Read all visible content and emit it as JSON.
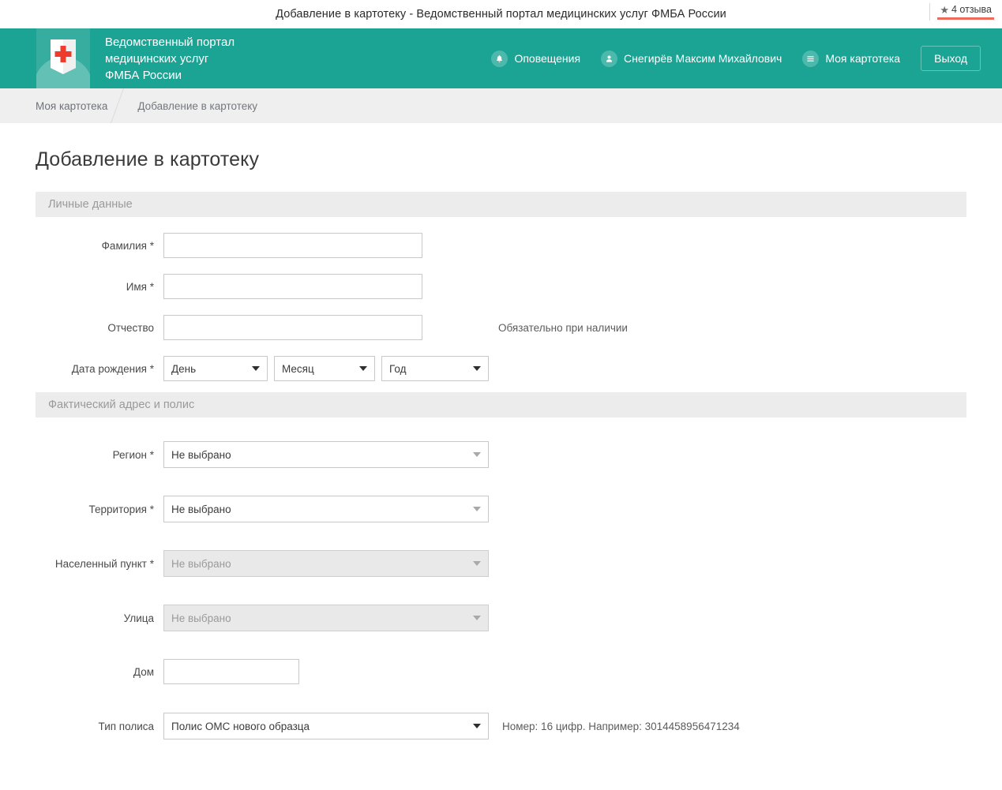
{
  "browser": {
    "title": "Добавление в картотеку - Ведомственный портал медицинских услуг ФМБА России",
    "review_badge": {
      "star": "★",
      "text": "4 отзыва"
    }
  },
  "header": {
    "brand_line1": "Ведомственный портал",
    "brand_line2": "медицинских услуг",
    "brand_line3": "ФМБА России",
    "nav": [
      {
        "label": "Оповещения",
        "icon": "bell-icon"
      },
      {
        "label": "Снегирёв Максим Михайлович",
        "icon": "user-icon"
      },
      {
        "label": "Моя картотека",
        "icon": "list-icon"
      }
    ],
    "logout_label": "Выход",
    "accent_color": "#1ba394"
  },
  "breadcrumb": {
    "items": [
      {
        "label": "Моя картотека"
      },
      {
        "label": "Добавление в картотеку"
      }
    ]
  },
  "main": {
    "page_title": "Добавление в картотеку",
    "sections": [
      {
        "title": "Личные данные"
      },
      {
        "title": "Фактический адрес и полис"
      }
    ],
    "personal": {
      "surname": {
        "label": "Фамилия *",
        "value": "",
        "placeholder": ""
      },
      "firstname": {
        "label": "Имя *",
        "value": "",
        "placeholder": ""
      },
      "patronymic": {
        "label": "Отчество",
        "value": "",
        "placeholder": "",
        "hint": "Обязательно при наличии"
      },
      "birthdate": {
        "label": "Дата рождения *",
        "day": "День",
        "month": "Месяц",
        "year": "Год"
      }
    },
    "address": {
      "region": {
        "label": "Регион *",
        "value": "Не выбрано",
        "disabled": false
      },
      "territory": {
        "label": "Территория *",
        "value": "Не выбрано",
        "disabled": false
      },
      "locality": {
        "label": "Населенный пункт *",
        "value": "Не выбрано",
        "disabled": true
      },
      "street": {
        "label": "Улица",
        "value": "Не выбрано",
        "disabled": true
      },
      "house": {
        "label": "Дом",
        "value": "",
        "placeholder": ""
      },
      "policy_type": {
        "label": "Тип полиса",
        "value": "Полис ОМС нового образца"
      },
      "policy_hint": "Номер: 16 цифр. Например: 3014458956471234"
    }
  }
}
